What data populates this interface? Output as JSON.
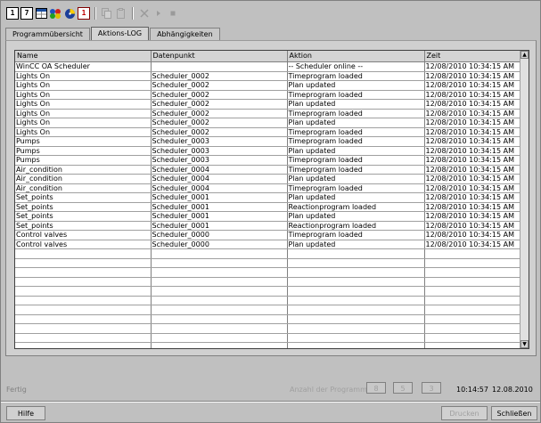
{
  "toolbar": {
    "buttons": [
      {
        "label": "1",
        "icon": "calendar-day-icon"
      },
      {
        "label": "7",
        "icon": "calendar-week-icon"
      },
      {
        "label": "",
        "icon": "calendar-month-icon"
      },
      {
        "label": "",
        "icon": "program-colors-icon"
      },
      {
        "label": "",
        "icon": "exception-program-icon"
      },
      {
        "label": "1",
        "icon": "calendar-red-icon"
      }
    ]
  },
  "tabs": [
    {
      "label": "Programmübersicht",
      "active": false
    },
    {
      "label": "Aktions-LOG",
      "active": true
    },
    {
      "label": "Abhängigkeiten",
      "active": false
    }
  ],
  "table": {
    "columns": [
      "Name",
      "Datenpunkt",
      "Aktion",
      "Zeit"
    ],
    "rows": [
      [
        "WinCC OA Scheduler",
        "",
        "-- Scheduler online --",
        "12/08/2010  10:34:15 AM"
      ],
      [
        "Lights On",
        "Scheduler_0002",
        "Timeprogram loaded",
        "12/08/2010  10:34:15 AM"
      ],
      [
        "Lights On",
        "Scheduler_0002",
        "Plan updated",
        "12/08/2010  10:34:15 AM"
      ],
      [
        "Lights On",
        "Scheduler_0002",
        "Timeprogram loaded",
        "12/08/2010  10:34:15 AM"
      ],
      [
        "Lights On",
        "Scheduler_0002",
        "Plan updated",
        "12/08/2010  10:34:15 AM"
      ],
      [
        "Lights On",
        "Scheduler_0002",
        "Timeprogram loaded",
        "12/08/2010  10:34:15 AM"
      ],
      [
        "Lights On",
        "Scheduler_0002",
        "Plan updated",
        "12/08/2010  10:34:15 AM"
      ],
      [
        "Lights On",
        "Scheduler_0002",
        "Timeprogram loaded",
        "12/08/2010  10:34:15 AM"
      ],
      [
        "Pumps",
        "Scheduler_0003",
        "Timeprogram loaded",
        "12/08/2010  10:34:15 AM"
      ],
      [
        "Pumps",
        "Scheduler_0003",
        "Plan updated",
        "12/08/2010  10:34:15 AM"
      ],
      [
        "Pumps",
        "Scheduler_0003",
        "Timeprogram loaded",
        "12/08/2010  10:34:15 AM"
      ],
      [
        "Air_condition",
        "Scheduler_0004",
        "Timeprogram loaded",
        "12/08/2010  10:34:15 AM"
      ],
      [
        "Air_condition",
        "Scheduler_0004",
        "Plan updated",
        "12/08/2010  10:34:15 AM"
      ],
      [
        "Air_condition",
        "Scheduler_0004",
        "Timeprogram loaded",
        "12/08/2010  10:34:15 AM"
      ],
      [
        "Set_points",
        "Scheduler_0001",
        "Plan updated",
        "12/08/2010  10:34:15 AM"
      ],
      [
        "Set_points",
        "Scheduler_0001",
        "Reactionprogram loaded",
        "12/08/2010  10:34:15 AM"
      ],
      [
        "Set_points",
        "Scheduler_0001",
        "Plan updated",
        "12/08/2010  10:34:15 AM"
      ],
      [
        "Set_points",
        "Scheduler_0001",
        "Reactionprogram loaded",
        "12/08/2010  10:34:15 AM"
      ],
      [
        "Control valves",
        "Scheduler_0000",
        "Timeprogram loaded",
        "12/08/2010  10:34:15 AM"
      ],
      [
        "Control valves",
        "Scheduler_0000",
        "Plan updated",
        "12/08/2010  10:34:15 AM"
      ]
    ]
  },
  "status": {
    "text": "Fertig",
    "program_count_label": "Anzahl der Programme:",
    "counts": [
      "8",
      "5",
      "3"
    ],
    "time": "10:14:57",
    "date": "12.08.2010"
  },
  "buttons": {
    "help": "Hilfe",
    "print": "Drucken",
    "close": "Schließen"
  },
  "colors": {
    "window_bg": "#c0c0c0",
    "table_bg": "#ffffff",
    "calendar_red": "#c00000"
  }
}
